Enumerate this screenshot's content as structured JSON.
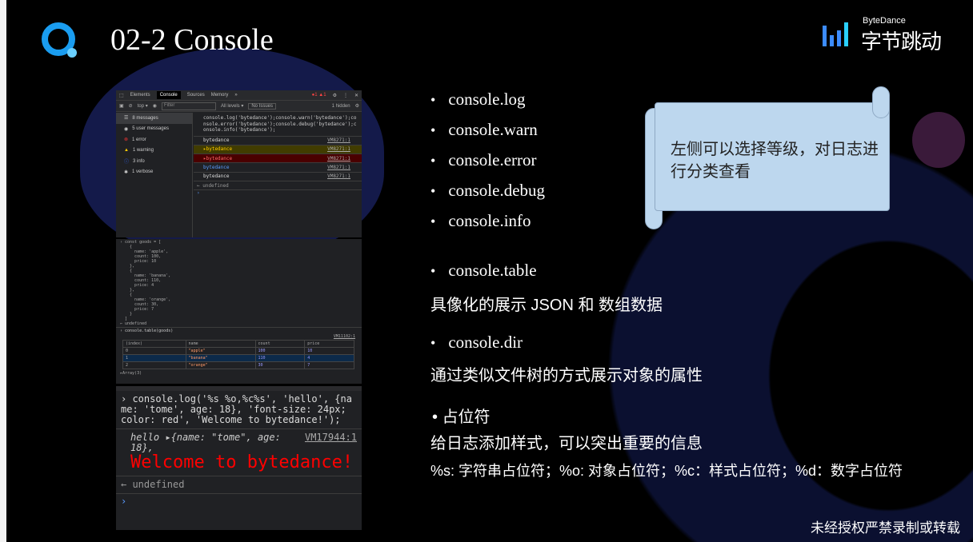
{
  "slide": {
    "title": "02-2 Console",
    "footer": "未经授权严禁录制或转载"
  },
  "brand": {
    "en": "ByteDance",
    "cn": "字节跳动",
    "accent": "#3c8cff"
  },
  "devtools": {
    "tabs": [
      "Elements",
      "Console",
      "Sources",
      "Memory",
      "»"
    ],
    "badges": "●1 ▲1",
    "toolbar": {
      "context": "top ▾",
      "filter_placeholder": "Filter",
      "levels": "All levels ▾",
      "issues": "No Issues",
      "hidden": "1 hidden"
    },
    "sidebar": [
      "8 messages",
      "5 user messages",
      "1 error",
      "1 warning",
      "3 info",
      "1 verbose"
    ],
    "command": "console.log('bytedance');console.warn('bytedance');console.error('bytedance');console.debug('bytedance');console.info('bytedance');",
    "rows": [
      {
        "text": "bytedance",
        "src": "VM8271:1",
        "level": "log"
      },
      {
        "text": "▸bytedance",
        "src": "VM8271:1",
        "level": "warn"
      },
      {
        "text": "▸bytedance",
        "src": "VM8271:1",
        "level": "error"
      },
      {
        "text": "bytedance",
        "src": "VM8271:1",
        "level": "info"
      },
      {
        "text": "bytedance",
        "src": "VM8271:1",
        "level": "debug"
      }
    ],
    "result": "← undefined",
    "prompt": "›"
  },
  "table_panel": {
    "code": "› const goods = [\n    {\n      name: 'apple',\n      count: 100,\n      price: 10\n    },\n    {\n      name: 'banana',\n      count: 110,\n      price: 4\n    },\n    {\n      name: 'orange',\n      count: 30,\n      price: 7\n    }\n  ]\n← undefined",
    "call": "› console.table(goods)",
    "src": "VM11102:1",
    "headers": [
      "(index)",
      "name",
      "count",
      "price"
    ],
    "rows": [
      [
        "0",
        "\"apple\"",
        "100",
        "10"
      ],
      [
        "1",
        "\"banana\"",
        "110",
        "4"
      ],
      [
        "2",
        "\"orange\"",
        "30",
        "7"
      ]
    ],
    "footer": "▸Array(3)"
  },
  "format_panel": {
    "command": "› console.log('%s %o,%c%s', 'hello', {name: 'tome', age: 18}, 'font-size: 24px; color: red', 'Welcome to bytedance!');",
    "hello": "hello ▸{name: \"tome\", age: 18},",
    "src": "VM17944:1",
    "welcome": "Welcome to bytedance!",
    "result": "← undefined",
    "prompt": "›"
  },
  "bullets": [
    "console.log",
    "console.warn",
    "console.error",
    "console.debug",
    "console.info"
  ],
  "callout": "左侧可以选择等级，对日志进行分类查看",
  "table_bullet": "console.table",
  "table_desc": "具像化的展示 JSON 和 数组数据",
  "dir_bullet": "console.dir",
  "dir_desc": "通过类似文件树的方式展示对象的属性",
  "ph_bullet": "占位符",
  "ph_desc": "给日志添加样式，可以突出重要的信息",
  "ph_detail": "%s: 字符串占位符；%o: 对象占位符；%c：样式占位符；%d：数字占位符"
}
